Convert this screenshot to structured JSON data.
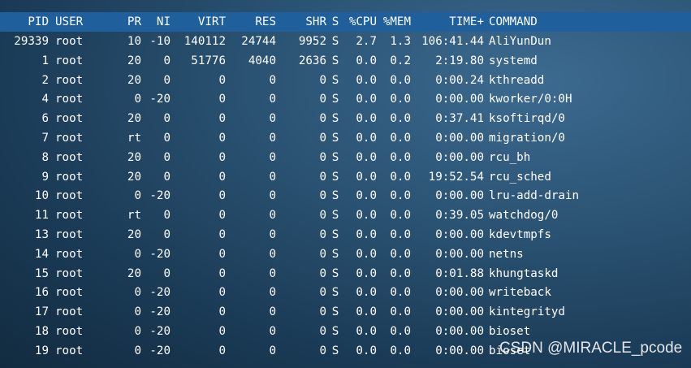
{
  "columns": [
    "PID",
    "USER",
    "PR",
    "NI",
    "VIRT",
    "RES",
    "SHR",
    "S",
    "%CPU",
    "%MEM",
    "TIME+",
    "COMMAND"
  ],
  "rows": [
    [
      "29339",
      "root",
      "10",
      "-10",
      "140112",
      "24744",
      "9952",
      "S",
      "2.7",
      "1.3",
      "106:41.44",
      "AliYunDun"
    ],
    [
      "1",
      "root",
      "20",
      "0",
      "51776",
      "4040",
      "2636",
      "S",
      "0.0",
      "0.2",
      "2:19.80",
      "systemd"
    ],
    [
      "2",
      "root",
      "20",
      "0",
      "0",
      "0",
      "0",
      "S",
      "0.0",
      "0.0",
      "0:00.24",
      "kthreadd"
    ],
    [
      "4",
      "root",
      "0",
      "-20",
      "0",
      "0",
      "0",
      "S",
      "0.0",
      "0.0",
      "0:00.00",
      "kworker/0:0H"
    ],
    [
      "6",
      "root",
      "20",
      "0",
      "0",
      "0",
      "0",
      "S",
      "0.0",
      "0.0",
      "0:37.41",
      "ksoftirqd/0"
    ],
    [
      "7",
      "root",
      "rt",
      "0",
      "0",
      "0",
      "0",
      "S",
      "0.0",
      "0.0",
      "0:00.00",
      "migration/0"
    ],
    [
      "8",
      "root",
      "20",
      "0",
      "0",
      "0",
      "0",
      "S",
      "0.0",
      "0.0",
      "0:00.00",
      "rcu_bh"
    ],
    [
      "9",
      "root",
      "20",
      "0",
      "0",
      "0",
      "0",
      "S",
      "0.0",
      "0.0",
      "19:52.54",
      "rcu_sched"
    ],
    [
      "10",
      "root",
      "0",
      "-20",
      "0",
      "0",
      "0",
      "S",
      "0.0",
      "0.0",
      "0:00.00",
      "lru-add-drain"
    ],
    [
      "11",
      "root",
      "rt",
      "0",
      "0",
      "0",
      "0",
      "S",
      "0.0",
      "0.0",
      "0:39.05",
      "watchdog/0"
    ],
    [
      "13",
      "root",
      "20",
      "0",
      "0",
      "0",
      "0",
      "S",
      "0.0",
      "0.0",
      "0:00.00",
      "kdevtmpfs"
    ],
    [
      "14",
      "root",
      "0",
      "-20",
      "0",
      "0",
      "0",
      "S",
      "0.0",
      "0.0",
      "0:00.00",
      "netns"
    ],
    [
      "15",
      "root",
      "20",
      "0",
      "0",
      "0",
      "0",
      "S",
      "0.0",
      "0.0",
      "0:01.88",
      "khungtaskd"
    ],
    [
      "16",
      "root",
      "0",
      "-20",
      "0",
      "0",
      "0",
      "S",
      "0.0",
      "0.0",
      "0:00.00",
      "writeback"
    ],
    [
      "17",
      "root",
      "0",
      "-20",
      "0",
      "0",
      "0",
      "S",
      "0.0",
      "0.0",
      "0:00.00",
      "kintegrityd"
    ],
    [
      "18",
      "root",
      "0",
      "-20",
      "0",
      "0",
      "0",
      "S",
      "0.0",
      "0.0",
      "0:00.00",
      "bioset"
    ],
    [
      "19",
      "root",
      "0",
      "-20",
      "0",
      "0",
      "0",
      "S",
      "0.0",
      "0.0",
      "0:00.00",
      "bioset"
    ]
  ],
  "watermark": "CSDN @MIRACLE_pcode"
}
